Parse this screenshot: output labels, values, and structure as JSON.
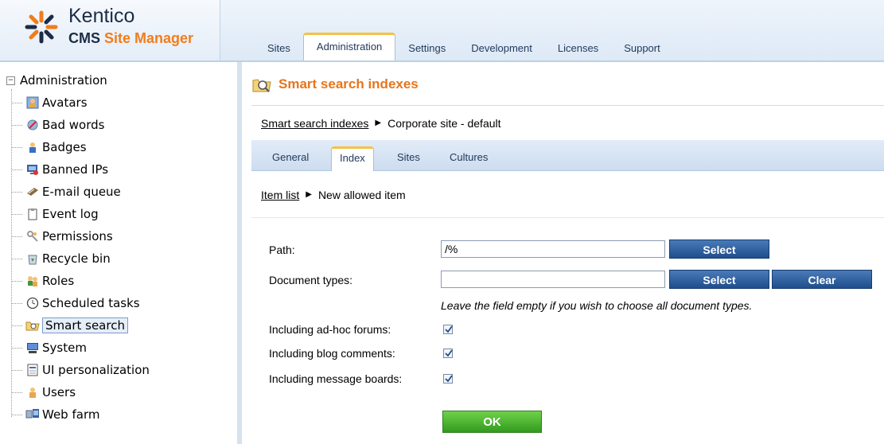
{
  "app": {
    "logo_name": "Kentico",
    "logo_sub_left": "CMS",
    "logo_sub_right": "Site Manager",
    "accent_color": "#f07d1c"
  },
  "top_tabs": [
    {
      "label": "Sites",
      "active": false
    },
    {
      "label": "Administration",
      "active": true
    },
    {
      "label": "Settings",
      "active": false
    },
    {
      "label": "Development",
      "active": false
    },
    {
      "label": "Licenses",
      "active": false
    },
    {
      "label": "Support",
      "active": false
    }
  ],
  "sidebar": {
    "root_label": "Administration",
    "root_toggle": "−",
    "items": [
      {
        "label": "Avatars",
        "icon": "avatar-icon"
      },
      {
        "label": "Bad words",
        "icon": "bad-words-icon"
      },
      {
        "label": "Badges",
        "icon": "badges-icon"
      },
      {
        "label": "Banned IPs",
        "icon": "banned-ip-icon"
      },
      {
        "label": "E-mail queue",
        "icon": "email-queue-icon"
      },
      {
        "label": "Event log",
        "icon": "event-log-icon"
      },
      {
        "label": "Permissions",
        "icon": "permissions-icon"
      },
      {
        "label": "Recycle bin",
        "icon": "recycle-bin-icon"
      },
      {
        "label": "Roles",
        "icon": "roles-icon"
      },
      {
        "label": "Scheduled tasks",
        "icon": "clock-icon"
      },
      {
        "label": "Smart search",
        "icon": "smart-search-icon",
        "selected": true
      },
      {
        "label": "System",
        "icon": "system-icon"
      },
      {
        "label": "UI personalization",
        "icon": "ui-personalization-icon"
      },
      {
        "label": "Users",
        "icon": "users-icon"
      },
      {
        "label": "Web farm",
        "icon": "web-farm-icon"
      }
    ]
  },
  "main": {
    "title": "Smart search indexes",
    "breadcrumb1": {
      "link": "Smart search indexes",
      "current": "Corporate site - default"
    },
    "sub_tabs": [
      {
        "label": "General",
        "active": false
      },
      {
        "label": "Index",
        "active": true
      },
      {
        "label": "Sites",
        "active": false
      },
      {
        "label": "Cultures",
        "active": false
      }
    ],
    "breadcrumb2": {
      "link": "Item list",
      "current": "New allowed item"
    },
    "form": {
      "path_label": "Path:",
      "path_value": "/%",
      "doc_types_label": "Document types:",
      "doc_types_value": "",
      "select_label": "Select",
      "clear_label": "Clear",
      "hint": "Leave the field empty if you wish to choose all document types.",
      "forums_label": "Including ad-hoc forums:",
      "blog_label": "Including blog comments:",
      "boards_label": "Including message boards:",
      "forums_checked": true,
      "blog_checked": true,
      "boards_checked": true,
      "ok_label": "OK"
    }
  }
}
